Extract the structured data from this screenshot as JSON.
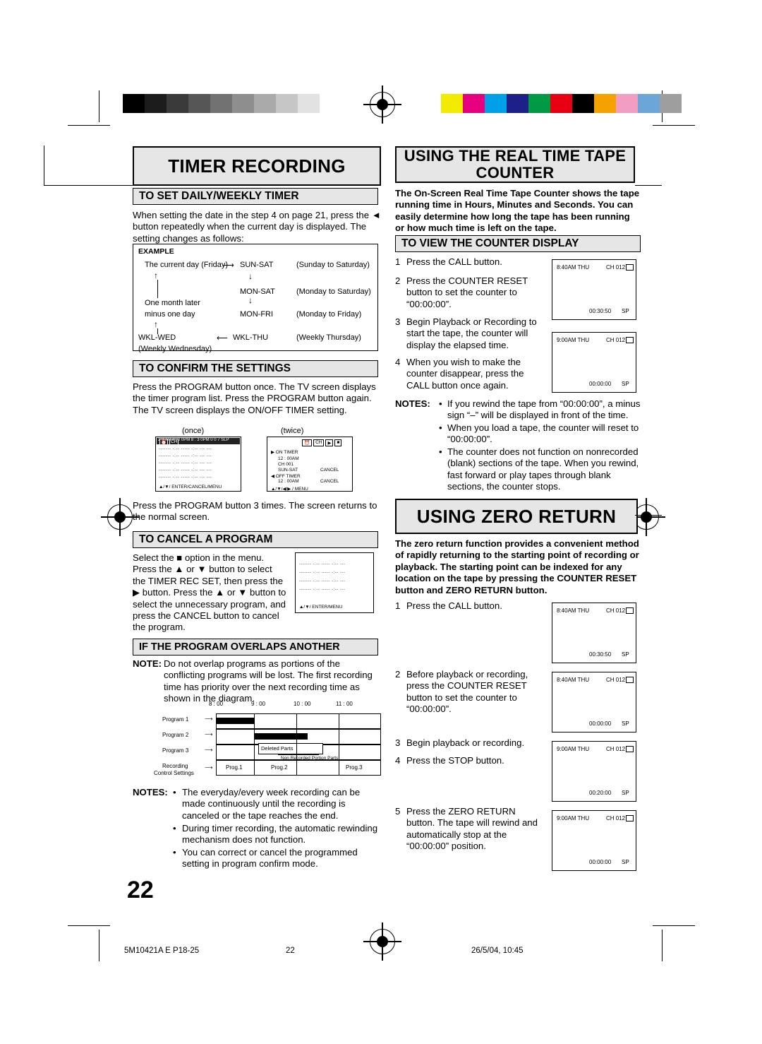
{
  "page": {
    "number": "22"
  },
  "footer": {
    "left": "5M10421A E P18-25",
    "center": "22",
    "right": "26/5/04, 10:45"
  },
  "left_column": {
    "title": "TIMER RECORDING",
    "section1": {
      "heading": "TO SET DAILY/WEEKLY TIMER",
      "paragraph": "When setting the date in the step 4 on page 21, press the ◄ button repeatedly when the current day is displayed. The setting changes as follows:",
      "example_label": "EXAMPLE",
      "rows": [
        {
          "left": "The current day (Friday)",
          "mid": "SUN-SAT",
          "right": "(Sunday to Saturday)"
        },
        {
          "left": "",
          "mid": "MON-SAT",
          "right": "(Monday to Saturday)"
        },
        {
          "left": "One month later",
          "mid": "",
          "right": ""
        },
        {
          "left": "minus one day",
          "mid": "MON-FRI",
          "right": "(Monday to Friday)"
        },
        {
          "left": "WKL-WED",
          "mid": "WKL-THU",
          "right": "(Weekly Thursday)"
        },
        {
          "left": "(Weekly Wednesday)",
          "mid": "",
          "right": ""
        }
      ]
    },
    "section2": {
      "heading": "TO CONFIRM THE SETTINGS",
      "paragraph": "Press the PROGRAM button once. The TV screen displays the timer program list. Press the PROGRAM button again. The TV screen displays the ON/OFF TIMER setting.",
      "label_once": "(once)",
      "label_twice": "(twice)",
      "screen_once": {
        "header": "2 3   TH   7 : 0 0PM   8 : 3 0PM  0 0 7   SLP",
        "footer": "▲/▼/ ENTER/CANCEL/MENU"
      },
      "screen_twice": {
        "line1": "▶ ON TIMER",
        "line2": "12 : 00AM",
        "line3": "CH 001",
        "line4": "SUN-SAT",
        "line5": "◀ OFF TIMER",
        "line6": "12 : 00AM",
        "cancel1": "CANCEL",
        "cancel2": "CANCEL",
        "footer": "▲/▼/◀/▶ / MENU"
      },
      "paragraph2": "Press the PROGRAM button 3 times. The screen returns to the normal screen."
    },
    "section3": {
      "heading": "TO CANCEL A PROGRAM",
      "paragraph": "Select the ■ option in the menu. Press the ▲ or ▼ button to select the TIMER REC SET, then press the ▶ button. Press the ▲ or ▼ button to select the unnecessary program, and press the CANCEL button to cancel the program.",
      "screen_footer": "▲/▼/ ENTER/MENU"
    },
    "section4": {
      "heading": "IF THE PROGRAM OVERLAPS ANOTHER",
      "note_label": "NOTE:",
      "note_text": "Do not overlap programs as portions of the conflicting programs will be lost. The first recording time has priority over the next recording time as shown in the diagram.",
      "diagram": {
        "times": [
          "8 : 00",
          "9 : 00",
          "10 : 00",
          "11 : 00"
        ],
        "rows": [
          "Program 1",
          "Program 2",
          "Program 3",
          "Recording",
          "Control Settings"
        ],
        "deleted_label": "Deleted Parts",
        "nonrecorded_label": "Non Recorded Portion Parts",
        "progs": [
          "Prog.1",
          "Prog.2",
          "Prog.3"
        ]
      },
      "notes_label": "NOTES:",
      "notes": [
        "The everyday/every week recording can be made continuously until the recording is canceled or the tape reaches the end.",
        "During timer recording, the automatic rewinding mechanism does not function.",
        "You can correct or cancel the programmed setting in program confirm mode."
      ]
    }
  },
  "right_column": {
    "title": "USING THE REAL TIME TAPE COUNTER",
    "intro": "The On-Screen Real Time Tape Counter shows the tape running time in Hours, Minutes and Seconds. You can easily determine how long the tape has been running or how much time is left on the tape.",
    "section1": {
      "heading": "TO VIEW THE COUNTER DISPLAY",
      "steps": [
        {
          "n": "1",
          "text": "Press the CALL button."
        },
        {
          "n": "2",
          "text": "Press the COUNTER RESET button to set the counter to “00:00:00”."
        },
        {
          "n": "3",
          "text": "Begin Playback or Recording to start the tape, the counter will display the elapsed time."
        },
        {
          "n": "4",
          "text": "When you wish to make the counter disappear, press the CALL button once again."
        }
      ],
      "screens": [
        {
          "time": "8:40AM THU",
          "ch": "CH 012",
          "counter": "00:30:50",
          "speed": "SP"
        },
        {
          "time": "9:00AM THU",
          "ch": "CH 012",
          "counter": "00:00:00",
          "speed": "SP"
        }
      ],
      "notes_label": "NOTES:",
      "notes": [
        "If you rewind the tape from “00:00:00”, a minus sign “–” will be displayed in front of the time.",
        "When you load a tape, the counter will reset to “00:00:00”.",
        "The counter does not function on nonrecorded (blank) sections of the tape. When you rewind, fast forward or play tapes through blank sections, the counter stops."
      ]
    },
    "section2": {
      "title": "USING ZERO RETURN",
      "intro": "The zero return function provides a convenient method of rapidly returning to the starting point of recording or playback. The starting point can be indexed for any location on the tape by pressing the COUNTER RESET button and ZERO RETURN button.",
      "steps": [
        {
          "n": "1",
          "text": "Press the CALL button."
        },
        {
          "n": "2",
          "text": "Before playback or recording, press the COUNTER RESET button to set the counter to “00:00:00”."
        },
        {
          "n": "3",
          "text": "Begin playback or recording."
        },
        {
          "n": "4",
          "text": "Press the STOP button."
        },
        {
          "n": "5",
          "text": "Press the ZERO RETURN button. The tape will rewind and automatically stop at the “00:00:00” position."
        }
      ],
      "screens": [
        {
          "time": "8:40AM THU",
          "ch": "CH 012",
          "counter": "00:30:50",
          "speed": "SP"
        },
        {
          "time": "8:40AM THU",
          "ch": "CH 012",
          "counter": "00:00:00",
          "speed": "SP"
        },
        {
          "time": "9:00AM THU",
          "ch": "CH 012",
          "counter": "00:20:00",
          "speed": "SP"
        },
        {
          "time": "9:00AM THU",
          "ch": "CH 012",
          "counter": "00:00:00",
          "speed": "SP"
        }
      ]
    }
  },
  "colors": {
    "header_bg": "#e6e6e6",
    "grey_steps": [
      "#000000",
      "#1c1c1c",
      "#3a3a3a",
      "#565656",
      "#727272",
      "#8e8e8e",
      "#aaaaaa",
      "#c6c6c6",
      "#e2e2e2",
      "#ffffff"
    ],
    "color_steps": [
      "#f2ea00",
      "#e6007e",
      "#00a0e9",
      "#1d2088",
      "#009944",
      "#e60012",
      "#000000",
      "#f5a200",
      "#f19ec2",
      "#6ca6d9",
      "#9e9e9e"
    ]
  }
}
